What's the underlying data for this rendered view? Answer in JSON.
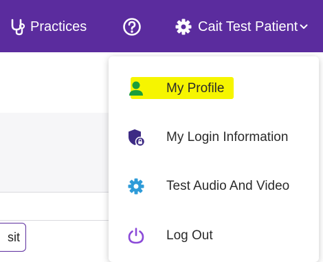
{
  "header": {
    "practices_label": "Practices",
    "user_label": "Cait Test Patient"
  },
  "page": {
    "partial_button_text": "sit"
  },
  "user_menu": {
    "items": [
      {
        "label": "My Profile",
        "icon": "person-icon",
        "highlighted": true
      },
      {
        "label": "My Login Information",
        "icon": "shield-lock-icon"
      },
      {
        "label": "Test Audio And Video",
        "icon": "gear-icon"
      },
      {
        "label": "Log Out",
        "icon": "power-icon"
      }
    ]
  },
  "colors": {
    "header_bg": "#5b2c9e",
    "profile_icon": "#1a9e3a",
    "login_icon": "#3d2a84",
    "av_icon": "#2e9bd8",
    "logout_icon": "#8b4ad8",
    "highlight": "#f6f500"
  }
}
